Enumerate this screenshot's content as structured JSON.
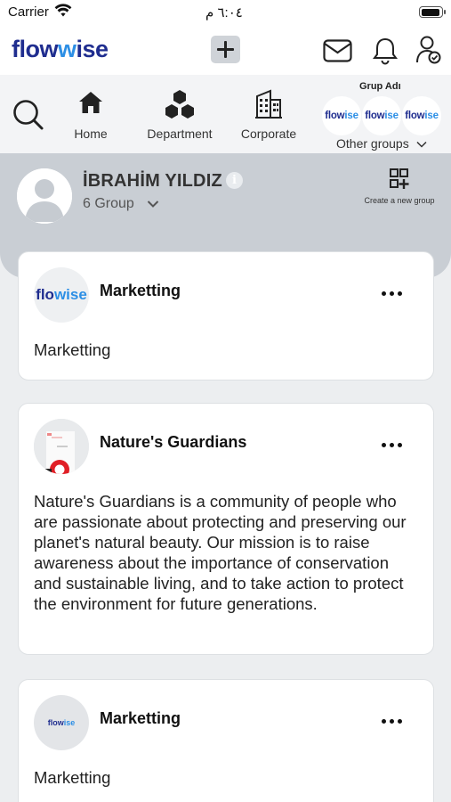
{
  "status_bar": {
    "carrier": "Carrier",
    "time": "٦:٠٤ م"
  },
  "header": {
    "logo_part1": "flow",
    "logo_part2": "ise",
    "logo_mid": "w",
    "icons": [
      "add-icon",
      "mail-icon",
      "bell-icon",
      "user-settings-icon"
    ]
  },
  "nav": {
    "items": [
      {
        "label": "Home",
        "icon": "home-icon"
      },
      {
        "label": "Department",
        "icon": "hexagons-icon"
      },
      {
        "label": "Corporate",
        "icon": "building-icon"
      }
    ],
    "groups_title": "Grup Adı",
    "group_logos": [
      {
        "p1": "flow",
        "p2": "ise"
      },
      {
        "p1": "flow",
        "p2": "ise"
      },
      {
        "p1": "flow",
        "p2": "ise"
      }
    ],
    "other_groups": "Other groups"
  },
  "profile": {
    "name": "İBRAHİM YILDIZ",
    "info": "i",
    "group_count": "6 Group",
    "create_group": "Create a new group"
  },
  "cards": [
    {
      "title": "Marketting",
      "description": "Marketting",
      "logo_p1": "flo",
      "logo_p2": "wise"
    },
    {
      "title": "Nature's Guardians",
      "description": "Nature's Guardians is a community of people who are passionate about protecting and preserving our planet's natural beauty. Our mission is to raise awareness about the importance of conservation and sustainable living, and to take action to protect the environment for future generations."
    },
    {
      "title": "Marketting",
      "description": "Marketting",
      "logo_p1": "flow",
      "logo_p2": "ise"
    }
  ],
  "colors": {
    "brand_dark": "#1f2d8f",
    "brand_light": "#2d8fe5",
    "profile_bg": "#c9ced4",
    "page_bg": "#eceef0"
  }
}
